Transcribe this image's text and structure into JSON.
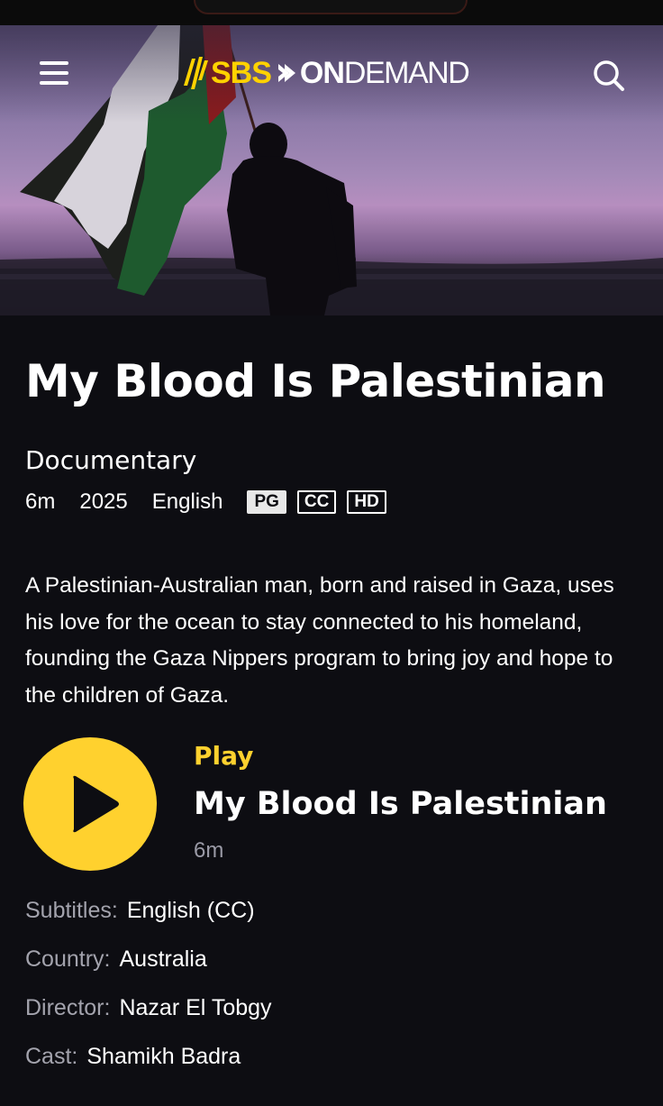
{
  "header": {
    "logo_text_sbs": "SBS",
    "logo_text_on": "ON",
    "logo_text_demand": "DEMAND",
    "menu_icon": "hamburger-menu-icon",
    "search_icon": "search-icon"
  },
  "program": {
    "title": "My Blood Is Palestinian",
    "genre": "Documentary",
    "duration": "6m",
    "year": "2025",
    "language": "English",
    "badges": [
      "PG",
      "CC",
      "HD"
    ],
    "description": "A Palestinian-Australian man, born and raised in Gaza, uses his love for the ocean to stay connected to his homeland, founding the Gaza Nippers program to bring joy and hope to the children of Gaza."
  },
  "player": {
    "play_label": "Play",
    "episode_title": "My Blood Is Palestinian",
    "episode_duration": "6m",
    "accent_color": "#ffd12e"
  },
  "details": [
    {
      "label": "Subtitles:",
      "value": "English (CC)"
    },
    {
      "label": "Country:",
      "value": "Australia"
    },
    {
      "label": "Director:",
      "value": "Nazar El Tobgy"
    },
    {
      "label": "Cast:",
      "value": "Shamikh Badra"
    }
  ]
}
